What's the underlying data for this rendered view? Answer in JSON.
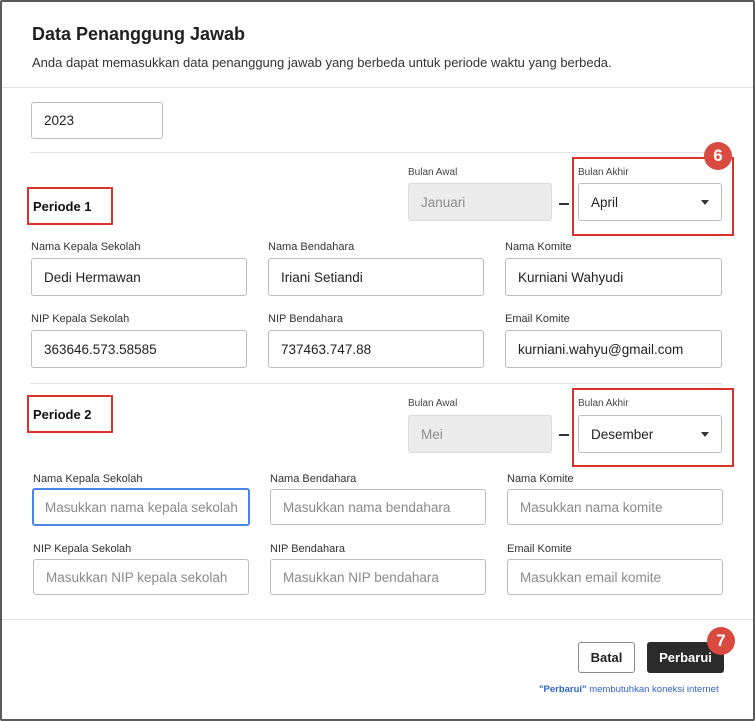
{
  "header": {
    "title": "Data Penanggung Jawab",
    "subtitle": "Anda dapat memasukkan data penanggung jawab yang berbeda untuk periode waktu yang berbeda."
  },
  "year": {
    "value": "2023"
  },
  "labels": {
    "bulan_awal": "Bulan Awal",
    "bulan_akhir": "Bulan Akhir",
    "nama_kepala_sekolah": "Nama Kepala Sekolah",
    "nama_bendahara": "Nama Bendahara",
    "nama_komite": "Nama Komite",
    "nip_kepala_sekolah": "NIP Kepala Sekolah",
    "nip_bendahara": "NIP Bendahara",
    "email_komite": "Email Komite"
  },
  "periode1": {
    "title": "Periode 1",
    "bulan_awal": "Januari",
    "bulan_akhir": "April",
    "nama_kepala_sekolah": "Dedi Hermawan",
    "nama_bendahara": "Iriani Setiandi",
    "nama_komite": "Kurniani Wahyudi",
    "nip_kepala_sekolah": "363646.573.58585",
    "nip_bendahara": "737463.747.88",
    "email_komite": "kurniani.wahyu@gmail.com"
  },
  "periode2": {
    "title": "Periode 2",
    "bulan_awal": "Mei",
    "bulan_akhir": "Desember",
    "placeholders": {
      "nama_kepala_sekolah": "Masukkan nama kepala sekolah",
      "nama_bendahara": "Masukkan nama bendahara",
      "nama_komite": "Masukkan nama komite",
      "nip_kepala_sekolah": "Masukkan NIP kepala sekolah",
      "nip_bendahara": "Masukkan NIP bendahara",
      "email_komite": "Masukkan email komite"
    }
  },
  "badges": {
    "b6": "6",
    "b7": "7"
  },
  "buttons": {
    "cancel": "Batal",
    "update": "Perbarui"
  },
  "footer": {
    "note_strong": "\"Perbarui\"",
    "note_rest": " membutuhkan koneksi internet"
  },
  "colors": {
    "annotation_red": "#d9342b",
    "badge_red": "#d94a3f",
    "focus_blue": "#4a86e8",
    "primary_dark": "#2b2b2b",
    "note_blue": "#2f64c9"
  }
}
